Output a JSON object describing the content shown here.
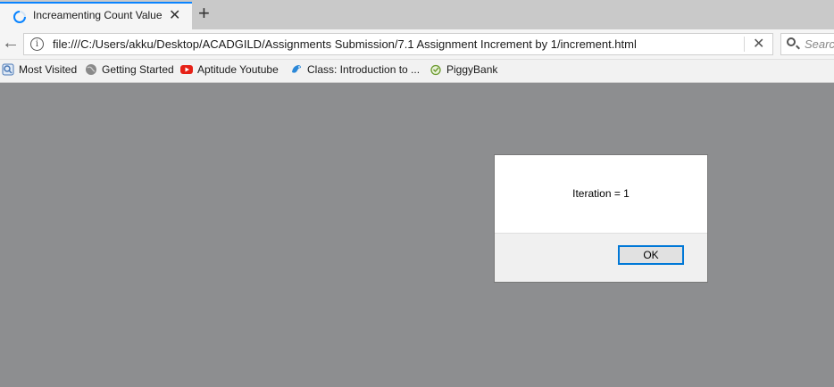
{
  "browser": {
    "tab": {
      "title": "Increamenting Count Value",
      "close_glyph": "✕"
    },
    "new_tab_glyph": "+",
    "url": "file:///C:/Users/akku/Desktop/ACADGILD/Assignments Submission/7.1 Assignment Increment by 1/increment.html",
    "url_clear_glyph": "✕",
    "search_placeholder": "Searc",
    "back_glyph": "←",
    "info_glyph": "i",
    "bookmarks": [
      {
        "label": "Most Visited",
        "icon": "most-visited-icon"
      },
      {
        "label": "Getting Started",
        "icon": "globe-icon"
      },
      {
        "label": "Aptitude Youtube",
        "icon": "youtube-icon"
      },
      {
        "label": "Class: Introduction to ...",
        "icon": "bird-icon"
      },
      {
        "label": "PiggyBank",
        "icon": "piggybank-icon"
      }
    ]
  },
  "dialog": {
    "message": "Iteration = 1",
    "ok_label": "OK"
  },
  "colors": {
    "overlay": "#8d8e90",
    "focus_accent": "#0078d7",
    "tab_accent": "#0a84ff",
    "youtube_red": "#e62117"
  }
}
